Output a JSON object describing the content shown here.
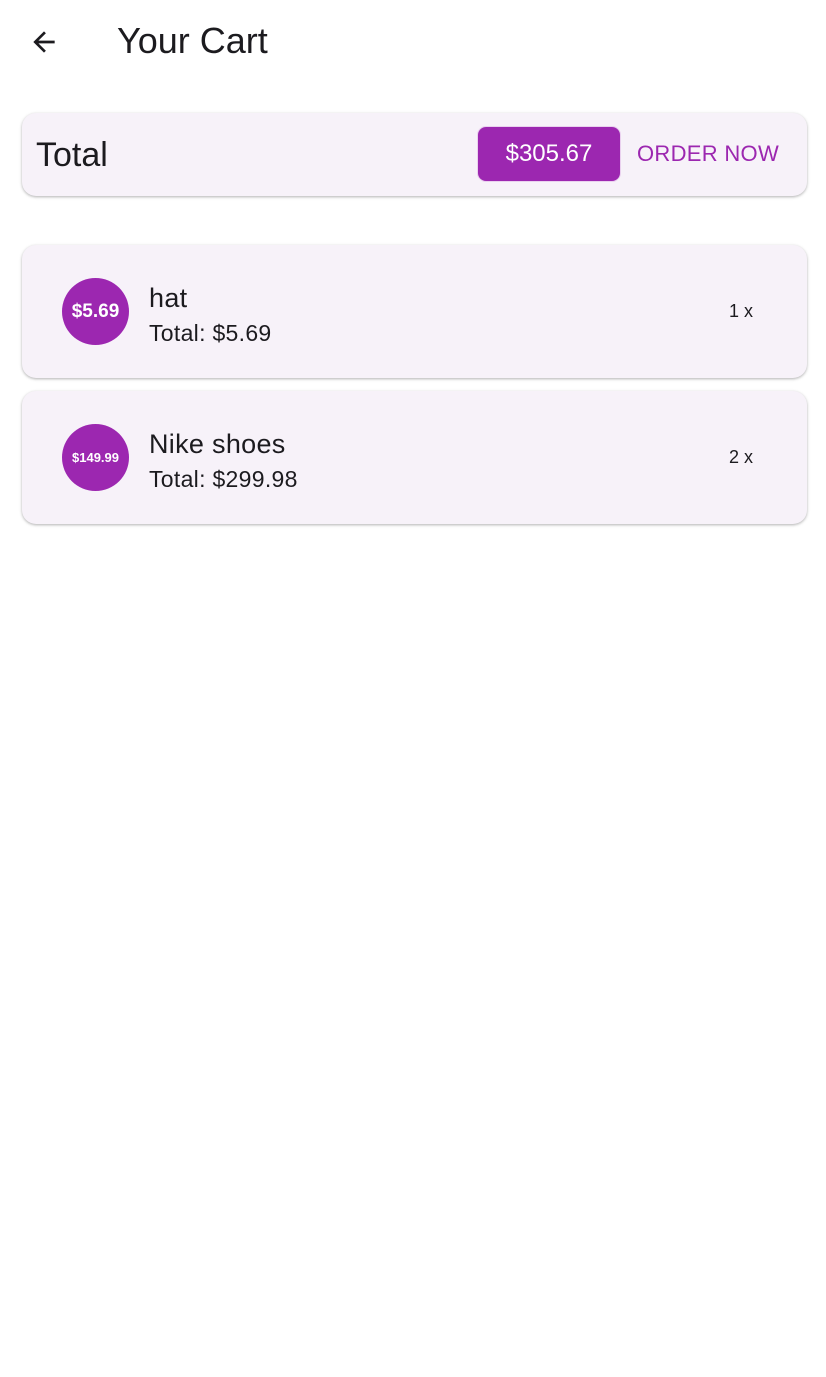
{
  "app_bar": {
    "back_icon": "arrow-back-icon",
    "title": "Your Cart"
  },
  "summary": {
    "label": "Total",
    "amount": "$305.67",
    "order_label": "ORDER NOW"
  },
  "items": [
    {
      "avatar_price": "$5.69",
      "name": "hat",
      "total": "Total: $5.69",
      "quantity": "1 x"
    },
    {
      "avatar_price": "$149.99",
      "name": "Nike shoes",
      "total": "Total: $299.98",
      "quantity": "2 x"
    }
  ],
  "colors": {
    "accent": "#9c27b0",
    "card_background": "#f7f2f9",
    "page_background": "#ffffff"
  }
}
